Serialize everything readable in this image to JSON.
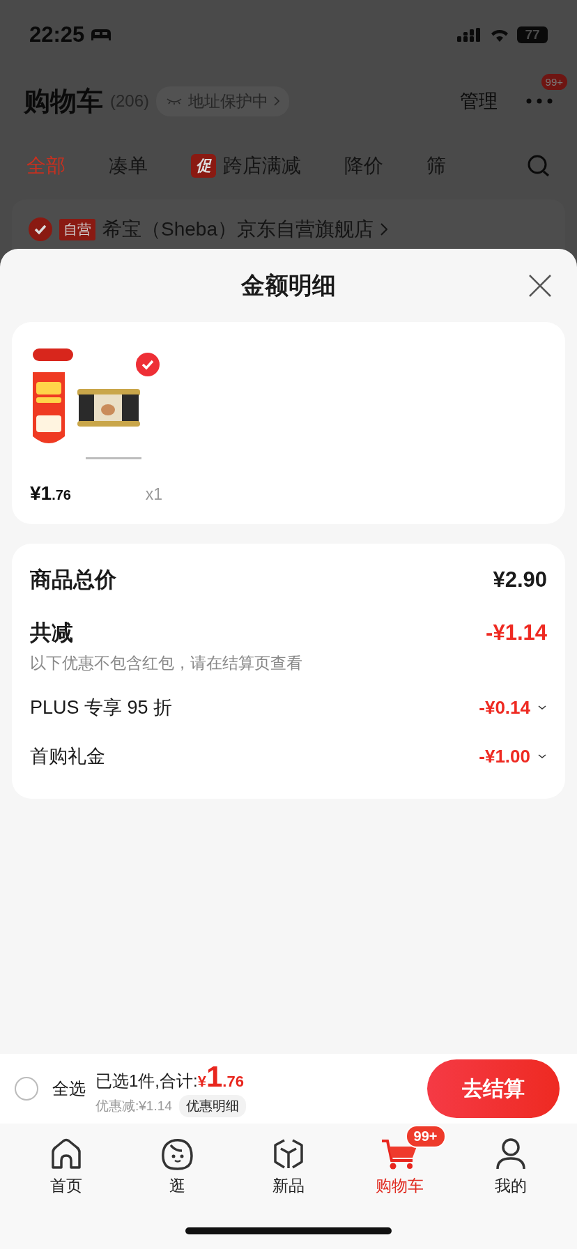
{
  "status_bar": {
    "time": "22:25",
    "battery": "77"
  },
  "header": {
    "title": "购物车",
    "count": "(206)",
    "address_badge": "地址保护中",
    "manage": "管理",
    "more_badge": "99+"
  },
  "filter_tabs": [
    {
      "label": "全部",
      "selected": true
    },
    {
      "label": "凑单",
      "selected": false
    },
    {
      "label": "跨店满减",
      "selected": false,
      "tag": "促"
    },
    {
      "label": "降价",
      "selected": false
    },
    {
      "label": "筛",
      "selected": false
    }
  ],
  "store": {
    "checked": true,
    "tag": "自营",
    "name": "希宝（Sheba）京东自营旗舰店"
  },
  "sheet": {
    "title": "金额明细",
    "items": [
      {
        "kind": "picture",
        "selected": true,
        "price_main": "¥1",
        "price_cents": ".76",
        "qty": "x1"
      }
    ],
    "summary": {
      "total_label": "商品总价",
      "total_value": "¥2.90",
      "reduce_label": "共减",
      "reduce_value": "-¥1.14",
      "note": "以下优惠不包含红包，请在结算页查看",
      "discounts": [
        {
          "label": "PLUS 专享 95 折",
          "value": "-¥0.14",
          "expanded": false
        },
        {
          "label": "首购礼金",
          "value": "-¥1.00",
          "expanded": false
        }
      ]
    }
  },
  "checkout_bar": {
    "select_all": {
      "label": "全选",
      "checked": false
    },
    "selected_text": "已选1件,合计:",
    "total_symbol": "¥",
    "total_main": "1",
    "total_cents": ".76",
    "saving": "优惠减:¥1.14",
    "detail_button": "优惠明细",
    "checkout_button": "去结算"
  },
  "nav": [
    {
      "label": "首页",
      "kind": "home",
      "selected": false
    },
    {
      "label": "逛",
      "kind": "face",
      "selected": false
    },
    {
      "label": "新品",
      "kind": "cube",
      "selected": false
    },
    {
      "label": "购物车",
      "kind": "cart",
      "selected": true,
      "badge": "99+"
    },
    {
      "label": "我的",
      "kind": "person",
      "selected": false
    }
  ]
}
